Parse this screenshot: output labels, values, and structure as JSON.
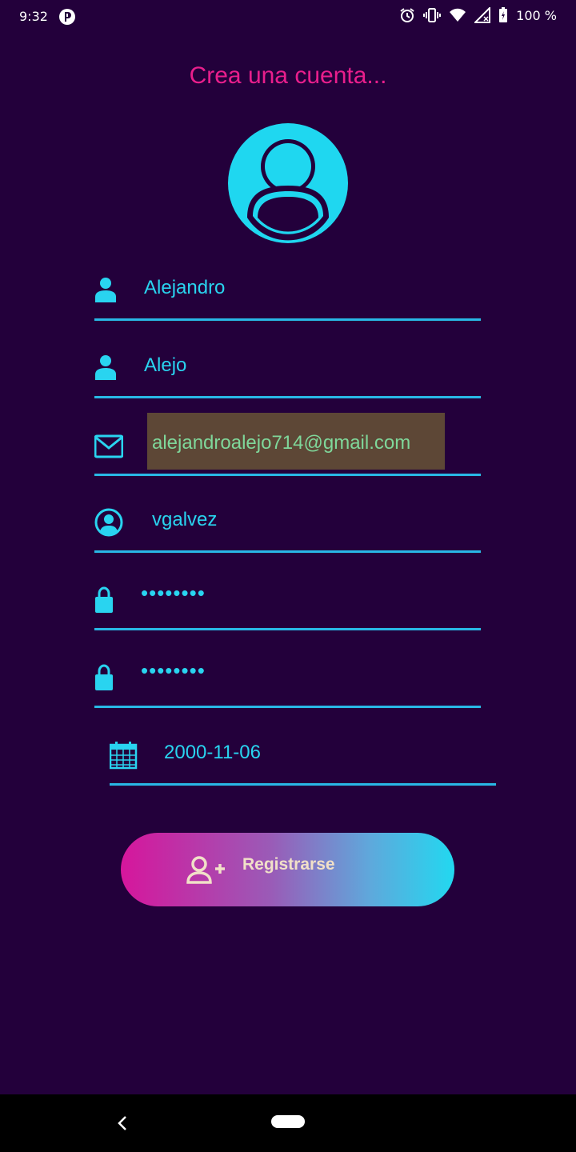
{
  "status_bar": {
    "time": "9:32",
    "battery": "100 %"
  },
  "form": {
    "title": "Crea una cuenta...",
    "first_name": "Alejandro",
    "last_name": "Alejo",
    "email": "alejandroalejo714@gmail.com",
    "username": "vgalvez",
    "password": "••••••••",
    "password_confirm": "••••••••",
    "birth_date": "2000-11-06"
  },
  "register_button": {
    "label": "Registrarse"
  },
  "colors": {
    "background": "#23003b",
    "accent": "#29d4f0",
    "title": "#e91e8c",
    "button_gradient_start": "#d6169c",
    "button_gradient_end": "#22d8f0"
  },
  "icons": {
    "first_name": "person-icon",
    "last_name": "person-icon",
    "email": "mail-icon",
    "username": "account-circle-icon",
    "password": "lock-icon",
    "password_confirm": "lock-icon",
    "birth_date": "calendar-icon",
    "register": "add-person-icon"
  }
}
